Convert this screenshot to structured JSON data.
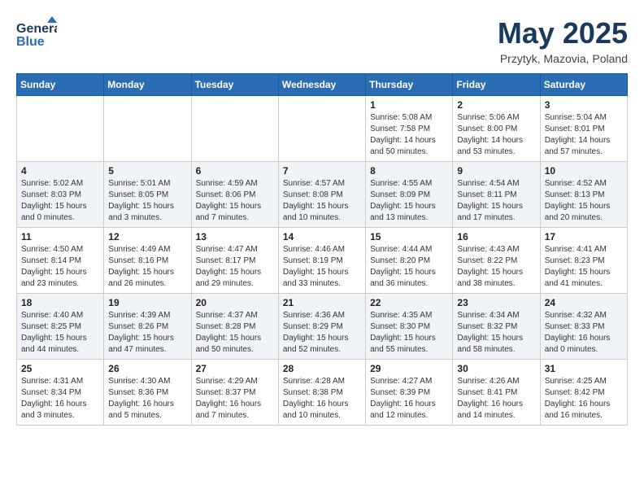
{
  "header": {
    "logo_line1": "General",
    "logo_line2": "Blue",
    "month": "May 2025",
    "location": "Przytyk, Mazovia, Poland"
  },
  "days_of_week": [
    "Sunday",
    "Monday",
    "Tuesday",
    "Wednesday",
    "Thursday",
    "Friday",
    "Saturday"
  ],
  "weeks": [
    [
      {
        "day": "",
        "info": ""
      },
      {
        "day": "",
        "info": ""
      },
      {
        "day": "",
        "info": ""
      },
      {
        "day": "",
        "info": ""
      },
      {
        "day": "1",
        "info": "Sunrise: 5:08 AM\nSunset: 7:58 PM\nDaylight: 14 hours\nand 50 minutes."
      },
      {
        "day": "2",
        "info": "Sunrise: 5:06 AM\nSunset: 8:00 PM\nDaylight: 14 hours\nand 53 minutes."
      },
      {
        "day": "3",
        "info": "Sunrise: 5:04 AM\nSunset: 8:01 PM\nDaylight: 14 hours\nand 57 minutes."
      }
    ],
    [
      {
        "day": "4",
        "info": "Sunrise: 5:02 AM\nSunset: 8:03 PM\nDaylight: 15 hours\nand 0 minutes."
      },
      {
        "day": "5",
        "info": "Sunrise: 5:01 AM\nSunset: 8:05 PM\nDaylight: 15 hours\nand 3 minutes."
      },
      {
        "day": "6",
        "info": "Sunrise: 4:59 AM\nSunset: 8:06 PM\nDaylight: 15 hours\nand 7 minutes."
      },
      {
        "day": "7",
        "info": "Sunrise: 4:57 AM\nSunset: 8:08 PM\nDaylight: 15 hours\nand 10 minutes."
      },
      {
        "day": "8",
        "info": "Sunrise: 4:55 AM\nSunset: 8:09 PM\nDaylight: 15 hours\nand 13 minutes."
      },
      {
        "day": "9",
        "info": "Sunrise: 4:54 AM\nSunset: 8:11 PM\nDaylight: 15 hours\nand 17 minutes."
      },
      {
        "day": "10",
        "info": "Sunrise: 4:52 AM\nSunset: 8:13 PM\nDaylight: 15 hours\nand 20 minutes."
      }
    ],
    [
      {
        "day": "11",
        "info": "Sunrise: 4:50 AM\nSunset: 8:14 PM\nDaylight: 15 hours\nand 23 minutes."
      },
      {
        "day": "12",
        "info": "Sunrise: 4:49 AM\nSunset: 8:16 PM\nDaylight: 15 hours\nand 26 minutes."
      },
      {
        "day": "13",
        "info": "Sunrise: 4:47 AM\nSunset: 8:17 PM\nDaylight: 15 hours\nand 29 minutes."
      },
      {
        "day": "14",
        "info": "Sunrise: 4:46 AM\nSunset: 8:19 PM\nDaylight: 15 hours\nand 33 minutes."
      },
      {
        "day": "15",
        "info": "Sunrise: 4:44 AM\nSunset: 8:20 PM\nDaylight: 15 hours\nand 36 minutes."
      },
      {
        "day": "16",
        "info": "Sunrise: 4:43 AM\nSunset: 8:22 PM\nDaylight: 15 hours\nand 38 minutes."
      },
      {
        "day": "17",
        "info": "Sunrise: 4:41 AM\nSunset: 8:23 PM\nDaylight: 15 hours\nand 41 minutes."
      }
    ],
    [
      {
        "day": "18",
        "info": "Sunrise: 4:40 AM\nSunset: 8:25 PM\nDaylight: 15 hours\nand 44 minutes."
      },
      {
        "day": "19",
        "info": "Sunrise: 4:39 AM\nSunset: 8:26 PM\nDaylight: 15 hours\nand 47 minutes."
      },
      {
        "day": "20",
        "info": "Sunrise: 4:37 AM\nSunset: 8:28 PM\nDaylight: 15 hours\nand 50 minutes."
      },
      {
        "day": "21",
        "info": "Sunrise: 4:36 AM\nSunset: 8:29 PM\nDaylight: 15 hours\nand 52 minutes."
      },
      {
        "day": "22",
        "info": "Sunrise: 4:35 AM\nSunset: 8:30 PM\nDaylight: 15 hours\nand 55 minutes."
      },
      {
        "day": "23",
        "info": "Sunrise: 4:34 AM\nSunset: 8:32 PM\nDaylight: 15 hours\nand 58 minutes."
      },
      {
        "day": "24",
        "info": "Sunrise: 4:32 AM\nSunset: 8:33 PM\nDaylight: 16 hours\nand 0 minutes."
      }
    ],
    [
      {
        "day": "25",
        "info": "Sunrise: 4:31 AM\nSunset: 8:34 PM\nDaylight: 16 hours\nand 3 minutes."
      },
      {
        "day": "26",
        "info": "Sunrise: 4:30 AM\nSunset: 8:36 PM\nDaylight: 16 hours\nand 5 minutes."
      },
      {
        "day": "27",
        "info": "Sunrise: 4:29 AM\nSunset: 8:37 PM\nDaylight: 16 hours\nand 7 minutes."
      },
      {
        "day": "28",
        "info": "Sunrise: 4:28 AM\nSunset: 8:38 PM\nDaylight: 16 hours\nand 10 minutes."
      },
      {
        "day": "29",
        "info": "Sunrise: 4:27 AM\nSunset: 8:39 PM\nDaylight: 16 hours\nand 12 minutes."
      },
      {
        "day": "30",
        "info": "Sunrise: 4:26 AM\nSunset: 8:41 PM\nDaylight: 16 hours\nand 14 minutes."
      },
      {
        "day": "31",
        "info": "Sunrise: 4:25 AM\nSunset: 8:42 PM\nDaylight: 16 hours\nand 16 minutes."
      }
    ]
  ]
}
